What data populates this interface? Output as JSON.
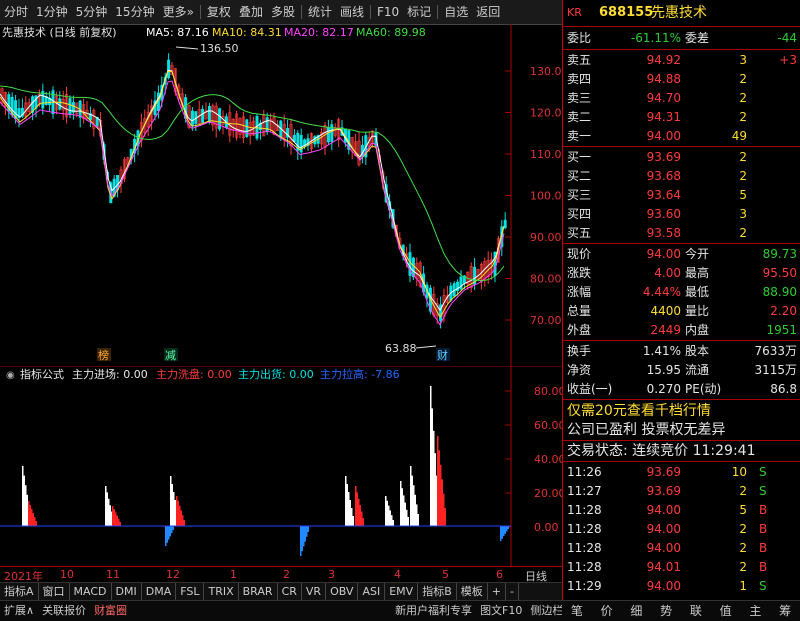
{
  "toolbar": {
    "items": [
      "分时",
      "1分钟",
      "5分钟",
      "15分钟",
      "更多»",
      "复权",
      "叠加",
      "多股",
      "统计",
      "画线",
      "F10",
      "标记",
      "自选",
      "返回"
    ]
  },
  "chart": {
    "title": "先惠技术 (日线 前复权)",
    "ma5_label": "MA5: 87.16",
    "ma10_label": "MA10: 84.31",
    "ma20_label": "MA20: 82.17",
    "ma60_label": "MA60: 89.98",
    "high_marker": "136.50",
    "low_marker": "63.88",
    "y_ticks": [
      "130.0",
      "120.0",
      "110.0",
      "100.0",
      "90.00",
      "80.00",
      "70.00"
    ],
    "tag_bang": "榜",
    "tag_jian": "减",
    "tag_cai": "财",
    "colors": {
      "ma5": "#ffffff",
      "ma10": "#ffdd33",
      "ma20": "#ff44ff",
      "ma60": "#44dd44",
      "up": "#ff3c3c",
      "down": "#00e0e0"
    }
  },
  "indicator": {
    "name": "指标公式",
    "entry_label": "主力进场: 0.00",
    "wash_label": "主力洗盘: 0.00",
    "ship_label": "主力出货: 0.00",
    "pull_label": "主力拉高: -7.86",
    "y_ticks": [
      "80.00",
      "60.00",
      "40.00",
      "20.00",
      "0.00"
    ]
  },
  "xaxis": {
    "labels": [
      "2021年",
      "10",
      "11",
      "12",
      "1",
      "2",
      "3",
      "4",
      "5",
      "6"
    ],
    "period": "日线"
  },
  "bottom_tabs": [
    "指标A",
    "窗口",
    "MACD",
    "DMI",
    "DMA",
    "FSL",
    "TRIX",
    "BRAR",
    "CR",
    "VR",
    "OBV",
    "ASI",
    "EMV",
    "指标B",
    "模板",
    "+",
    "-"
  ],
  "bottom_bar2": [
    "扩展∧",
    "关联报价",
    "财富圈",
    "新用户福利专享",
    "图文F10",
    "侧边栏《"
  ],
  "right_tabs": [
    "笔",
    "价",
    "细",
    "势",
    "联",
    "值",
    "主",
    "筹"
  ],
  "quote": {
    "code": "688155",
    "name": "先惠技术",
    "kr": "KR",
    "webi_label": "委比",
    "webi_value": "-61.11%",
    "wecha_label": "委差",
    "wecha_value": "-44",
    "asks": [
      {
        "label": "卖五",
        "price": "94.92",
        "vol": "3",
        "chg": "+3"
      },
      {
        "label": "卖四",
        "price": "94.88",
        "vol": "2",
        "chg": ""
      },
      {
        "label": "卖三",
        "price": "94.70",
        "vol": "2",
        "chg": ""
      },
      {
        "label": "卖二",
        "price": "94.31",
        "vol": "2",
        "chg": ""
      },
      {
        "label": "卖一",
        "price": "94.00",
        "vol": "49",
        "chg": ""
      }
    ],
    "bids": [
      {
        "label": "买一",
        "price": "93.69",
        "vol": "2"
      },
      {
        "label": "买二",
        "price": "93.68",
        "vol": "2"
      },
      {
        "label": "买三",
        "price": "93.64",
        "vol": "5"
      },
      {
        "label": "买四",
        "price": "93.60",
        "vol": "3"
      },
      {
        "label": "买五",
        "price": "93.58",
        "vol": "2"
      }
    ],
    "stats": [
      {
        "l1": "现价",
        "v1": "94.00",
        "l2": "今开",
        "v2": "89.73",
        "c1": "red",
        "c2": "green"
      },
      {
        "l1": "涨跌",
        "v1": "4.00",
        "l2": "最高",
        "v2": "95.50",
        "c1": "red",
        "c2": "red"
      },
      {
        "l1": "涨幅",
        "v1": "4.44%",
        "l2": "最低",
        "v2": "88.90",
        "c1": "red",
        "c2": "green"
      },
      {
        "l1": "总量",
        "v1": "4400",
        "l2": "量比",
        "v2": "2.20",
        "c1": "yellow",
        "c2": "red"
      },
      {
        "l1": "外盘",
        "v1": "2449",
        "l2": "内盘",
        "v2": "1951",
        "c1": "red",
        "c2": "green"
      }
    ],
    "stats2": [
      {
        "l1": "换手",
        "v1": "1.41%",
        "l2": "股本",
        "v2": "7633万"
      },
      {
        "l1": "净资",
        "v1": "15.95",
        "l2": "流通",
        "v2": "3115万"
      },
      {
        "l1": "收益(一)",
        "v1": "0.270",
        "l2": "PE(动)",
        "v2": "86.8"
      }
    ],
    "promo": "仅需20元查看千档行情",
    "company_note": "公司已盈利 投票权无差异",
    "trade_state": "交易状态: 连续竞价 11:29:41",
    "ticks": [
      {
        "time": "11:26",
        "price": "93.69",
        "vol": "10",
        "side": "S"
      },
      {
        "time": "11:27",
        "price": "93.69",
        "vol": "2",
        "side": "S"
      },
      {
        "time": "11:28",
        "price": "94.00",
        "vol": "5",
        "side": "B"
      },
      {
        "time": "11:28",
        "price": "94.00",
        "vol": "2",
        "side": "B"
      },
      {
        "time": "11:28",
        "price": "94.00",
        "vol": "2",
        "side": "B"
      },
      {
        "time": "11:28",
        "price": "94.01",
        "vol": "2",
        "side": "B"
      },
      {
        "time": "11:29",
        "price": "94.00",
        "vol": "1",
        "side": "S"
      }
    ]
  }
}
